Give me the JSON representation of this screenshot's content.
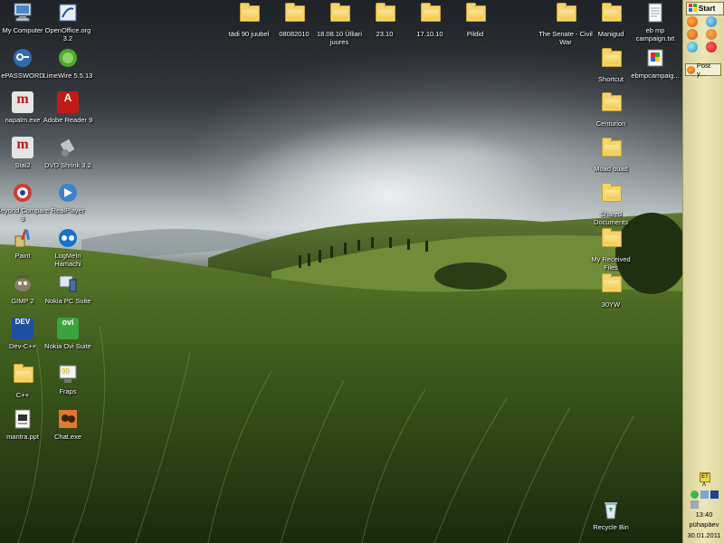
{
  "desktop": {
    "left_column": [
      {
        "label": "My Computer",
        "icon": "computer-icon"
      },
      {
        "label": "ePASSWORD",
        "icon": "key-icon"
      },
      {
        "label": "napalm.exe",
        "icon": "program-icon"
      },
      {
        "label": "Stai2",
        "icon": "program-icon"
      },
      {
        "label": "Beyond Compare 3",
        "icon": "compare-icon"
      },
      {
        "label": "Paint",
        "icon": "paint-icon"
      },
      {
        "label": "GIMP 2",
        "icon": "gimp-icon"
      },
      {
        "label": "Dev-C++",
        "icon": "devcpp-icon"
      },
      {
        "label": "C++",
        "icon": "folder-icon"
      },
      {
        "label": "mantra.ppt",
        "icon": "document-icon"
      }
    ],
    "second_column": [
      {
        "label": "OpenOffice.org 3.2",
        "icon": "openoffice-icon"
      },
      {
        "label": "LimeWire 5.5.13",
        "icon": "limewire-icon"
      },
      {
        "label": "Adobe Reader 9",
        "icon": "pdf-icon"
      },
      {
        "label": "DVD Shrink 3.2",
        "icon": "dvd-icon"
      },
      {
        "label": "RealPlayer",
        "icon": "realplayer-icon"
      },
      {
        "label": "LogMeIn Hamachi",
        "icon": "hamachi-icon"
      },
      {
        "label": "Nokia PC Suite",
        "icon": "nokia-icon"
      },
      {
        "label": "Nokia Ovi Suite",
        "icon": "ovi-icon"
      },
      {
        "label": "Fraps",
        "icon": "fraps-icon"
      },
      {
        "label": "Chat.exe",
        "icon": "chat-icon"
      }
    ],
    "top_row": [
      {
        "label": "tädi 90 juubel",
        "icon": "folder-icon"
      },
      {
        "label": "08082010",
        "icon": "folder-icon"
      },
      {
        "label": "18.08.10 Ülliari juures",
        "icon": "folder-icon"
      },
      {
        "label": "23.10",
        "icon": "folder-icon"
      },
      {
        "label": "17.10.10",
        "icon": "folder-icon"
      },
      {
        "label": "Pildid",
        "icon": "folder-icon"
      },
      {
        "label": "The Senate - Civil War",
        "icon": "folder-icon"
      }
    ],
    "right_column": [
      {
        "label": "Manigud",
        "icon": "folder-icon"
      },
      {
        "label": "Shortcut",
        "icon": "folder-icon"
      },
      {
        "label": "Centurion",
        "icon": "folder-icon"
      },
      {
        "label": "Moad ouad",
        "icon": "folder-icon"
      },
      {
        "label": "Shared Documents",
        "icon": "folder-icon"
      },
      {
        "label": "My Received Files",
        "icon": "folder-icon"
      },
      {
        "label": "30YW",
        "icon": "folder-icon"
      }
    ],
    "far_right_column": [
      {
        "label": "eb mp campaign.txt",
        "icon": "text-file-icon"
      },
      {
        "label": "ebmpcampaig...",
        "icon": "installer-icon"
      }
    ],
    "recycle_bin": {
      "label": "Recycle Bin",
      "icon": "recycle-bin-icon"
    }
  },
  "taskbar": {
    "start_label": "Start",
    "task_label": "Post y...",
    "language": "ET",
    "clock": "13:40",
    "weekday": "pühapäev",
    "date": "30.01.2011"
  },
  "colors": {
    "taskbar_bg": "#ece6b6",
    "folder_yellow": "#f4d46b"
  }
}
